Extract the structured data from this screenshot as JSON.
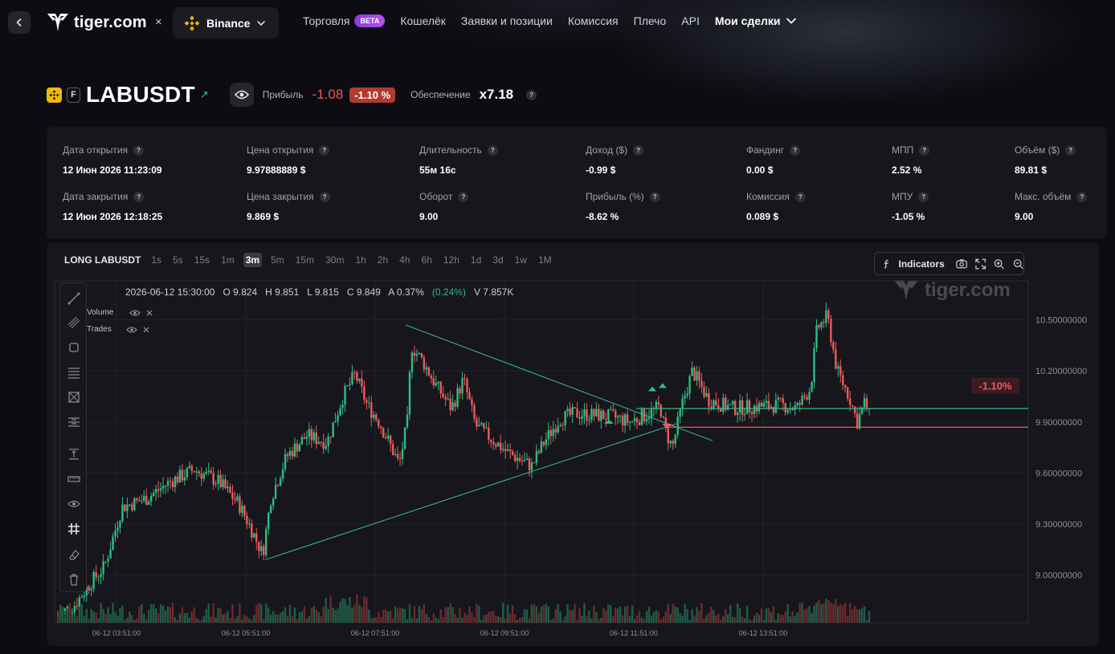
{
  "header": {
    "logo_text": "tiger.com",
    "close_symbol": "×",
    "exchange": "Binance",
    "nav": [
      {
        "label": "Торговля",
        "badge": "BETA"
      },
      {
        "label": "Кошелёк"
      },
      {
        "label": "Заявки и позиции"
      },
      {
        "label": "Комиссия"
      },
      {
        "label": "Плечо"
      },
      {
        "label": "API"
      },
      {
        "label": "Мои сделки"
      }
    ]
  },
  "position": {
    "exchange_badge": "binance-icon",
    "type_badge": "F",
    "symbol": "LABUSDT",
    "profit_label": "Прибыль",
    "profit_value": "-1.08",
    "profit_percent": "-1.10 %",
    "collateral_label": "Обеспечение",
    "collateral_value": "x7.18",
    "help_mark": "?"
  },
  "stats": [
    {
      "label": "Дата открытия",
      "value": "12 Июн 2026 11:23:09"
    },
    {
      "label": "Цена открытия",
      "value": "9.97888889 $"
    },
    {
      "label": "Длительность",
      "value": "55м 16с"
    },
    {
      "label": "Доход ($)",
      "value": "-0.99 $"
    },
    {
      "label": "Фандинг",
      "value": "0.00 $"
    },
    {
      "label": "МПП",
      "value": "2.52 %"
    },
    {
      "label": "Объём ($)",
      "value": "89.81 $"
    },
    {
      "label": "Дата закрытия",
      "value": "12 Июн 2026 12:18:25"
    },
    {
      "label": "Цена закрытия",
      "value": "9.869 $"
    },
    {
      "label": "Оборот",
      "value": "9.00"
    },
    {
      "label": "Прибыль (%)",
      "value": "-8.62 %"
    },
    {
      "label": "Комиссия",
      "value": "0.089 $"
    },
    {
      "label": "МПУ",
      "value": "-1.05 %"
    },
    {
      "label": "Макс. объём",
      "value": "9.00"
    }
  ],
  "chart": {
    "title": "LONG LABUSDT",
    "timeframes": [
      "1s",
      "5s",
      "15s",
      "1m",
      "3m",
      "5m",
      "15m",
      "30m",
      "1h",
      "2h",
      "4h",
      "6h",
      "12h",
      "1d",
      "3d",
      "1w",
      "1M"
    ],
    "active_timeframe": "3m",
    "indicators_label": "Indicators",
    "watermark": "tiger.com",
    "ohlc": {
      "time": "2026-06-12 15:30:00",
      "open": "O 9.824",
      "high": "H 9.851",
      "low": "L 9.815",
      "close": "C 9.849",
      "change": "A 0.37%",
      "change_pct": "(0.24%)",
      "volume": "V 7.857K"
    },
    "legend": [
      {
        "label": "Volume"
      },
      {
        "label": "Trades"
      }
    ],
    "pnl_tag": "-1.10%",
    "colors": {
      "up": "#2ebd85",
      "down": "#f0595a",
      "trendline": "#35c2a0"
    }
  },
  "chart_data": {
    "type": "candlestick",
    "y_ticks": [
      "10.50000000",
      "10.20000000",
      "9.90000000",
      "9.60000000",
      "9.30000000",
      "9.00000000"
    ],
    "x_ticks": [
      "06-12 03:51:00",
      "06-12 05:51:00",
      "06-12 07:51:00",
      "06-12 09:51:00",
      "06-12 11:51:00",
      "06-12 13:51:00"
    ],
    "ylim": [
      8.72,
      10.72
    ],
    "entry_price": 9.97888889,
    "exit_price": 9.869,
    "last_close": 9.849,
    "grid": true
  }
}
